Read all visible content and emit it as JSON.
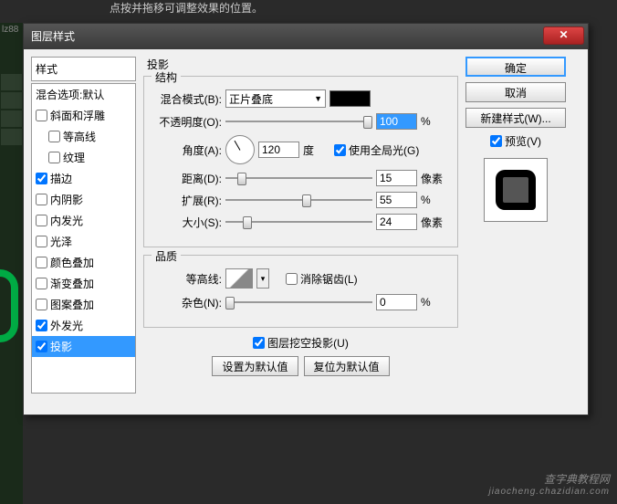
{
  "bg_hint": "点按并拖移可调整效果的位置。",
  "bg_tag": "lz88",
  "dialog": {
    "title": "图层样式",
    "styles_header": "样式",
    "styles": [
      {
        "label": "混合选项:默认",
        "checked": null,
        "indent": false
      },
      {
        "label": "斜面和浮雕",
        "checked": false,
        "indent": false
      },
      {
        "label": "等高线",
        "checked": false,
        "indent": true
      },
      {
        "label": "纹理",
        "checked": false,
        "indent": true
      },
      {
        "label": "描边",
        "checked": true,
        "indent": false
      },
      {
        "label": "内阴影",
        "checked": false,
        "indent": false
      },
      {
        "label": "内发光",
        "checked": false,
        "indent": false
      },
      {
        "label": "光泽",
        "checked": false,
        "indent": false
      },
      {
        "label": "颜色叠加",
        "checked": false,
        "indent": false
      },
      {
        "label": "渐变叠加",
        "checked": false,
        "indent": false
      },
      {
        "label": "图案叠加",
        "checked": false,
        "indent": false
      },
      {
        "label": "外发光",
        "checked": true,
        "indent": false
      },
      {
        "label": "投影",
        "checked": true,
        "indent": false,
        "selected": true
      }
    ],
    "section": "投影",
    "structure": {
      "legend": "结构",
      "blend_mode_label": "混合模式(B):",
      "blend_mode_value": "正片叠底",
      "opacity_label": "不透明度(O):",
      "opacity_value": "100",
      "opacity_unit": "%",
      "angle_label": "角度(A):",
      "angle_value": "120",
      "angle_unit": "度",
      "global_light": "使用全局光(G)",
      "global_light_checked": true,
      "distance_label": "距离(D):",
      "distance_value": "15",
      "distance_unit": "像素",
      "spread_label": "扩展(R):",
      "spread_value": "55",
      "spread_unit": "%",
      "size_label": "大小(S):",
      "size_value": "24",
      "size_unit": "像素"
    },
    "quality": {
      "legend": "品质",
      "contour_label": "等高线:",
      "antialias": "消除锯齿(L)",
      "antialias_checked": false,
      "noise_label": "杂色(N):",
      "noise_value": "0",
      "noise_unit": "%"
    },
    "knockout": {
      "label": "图层挖空投影(U)",
      "checked": true
    },
    "set_default": "设置为默认值",
    "reset_default": "复位为默认值",
    "buttons": {
      "ok": "确定",
      "cancel": "取消",
      "new_style": "新建样式(W)...",
      "preview": "预览(V)",
      "preview_checked": true
    }
  },
  "watermark": {
    "main": "查字典教程网",
    "sub": "jiaocheng.chazidian.com"
  }
}
